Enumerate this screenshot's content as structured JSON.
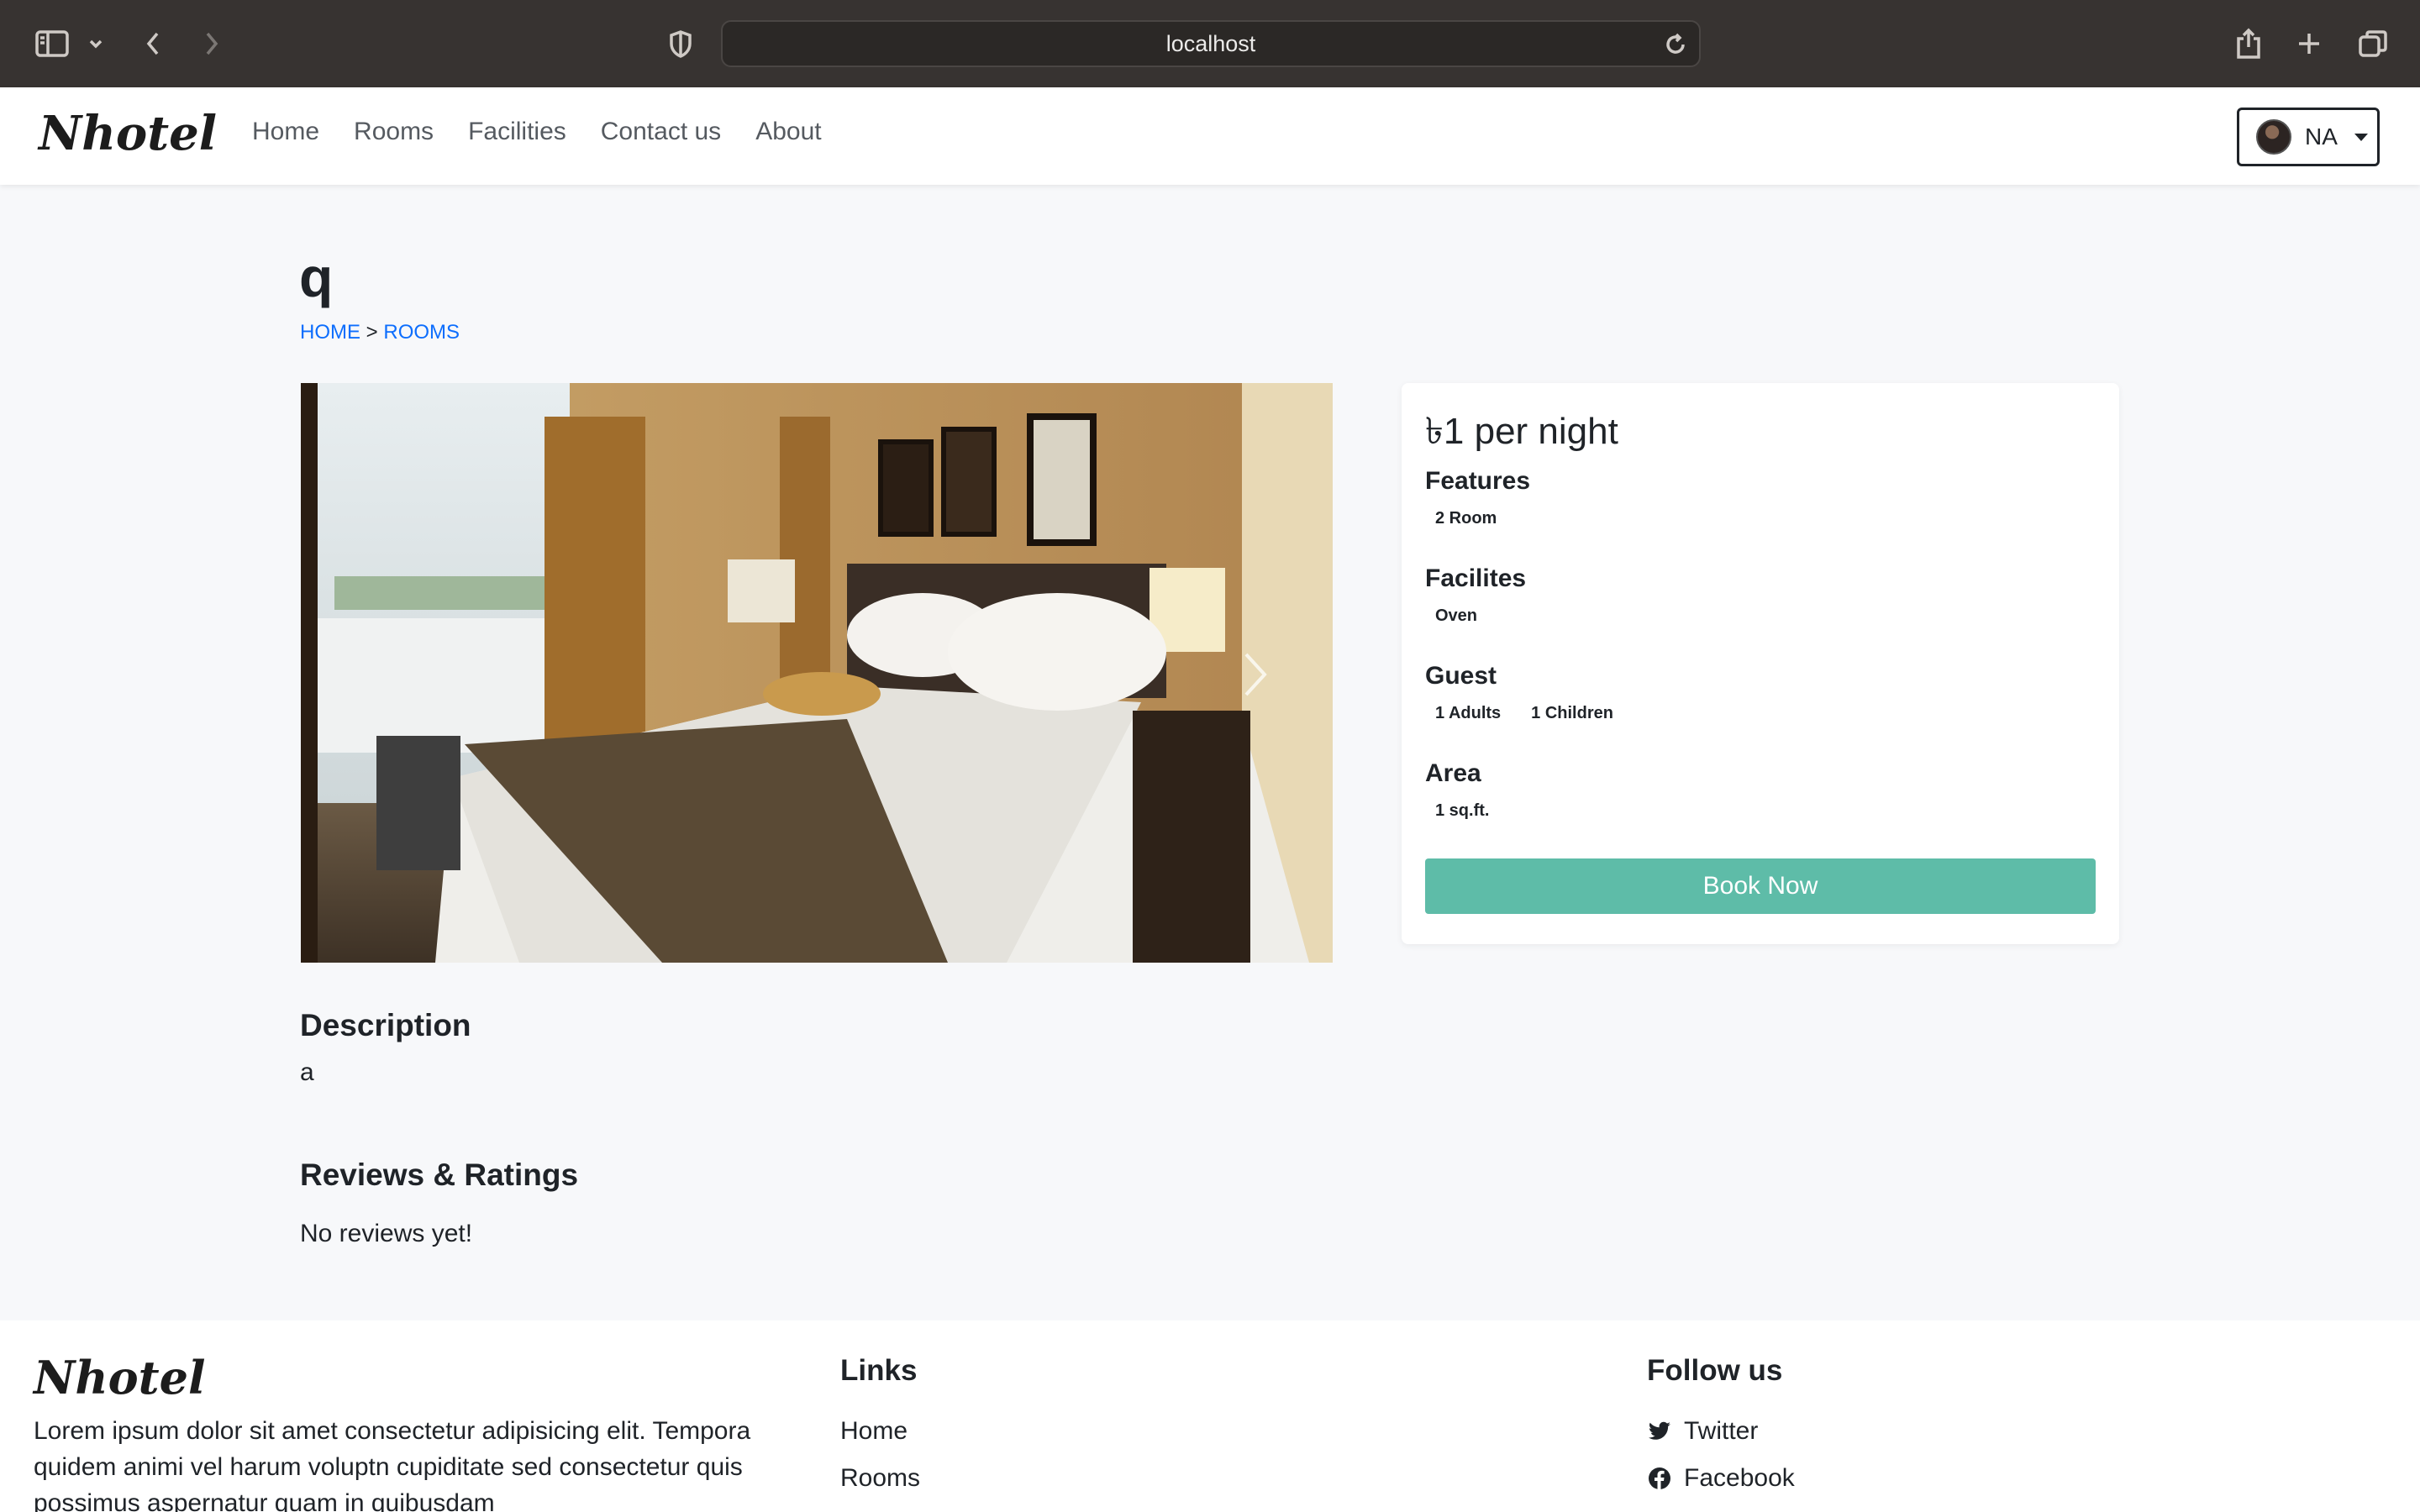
{
  "browser": {
    "url": "localhost"
  },
  "navbar": {
    "brand": "Nhotel",
    "links": [
      "Home",
      "Rooms",
      "Facilities",
      "Contact us",
      "About"
    ],
    "user_initials": "NA"
  },
  "room": {
    "title": "q",
    "breadcrumb": {
      "home": "HOME",
      "separator": ">",
      "rooms": "ROOMS"
    },
    "price": "৳1 per night",
    "features_title": "Features",
    "features": [
      "2 Room"
    ],
    "facilities_title": "Facilites",
    "facilities": [
      "Oven"
    ],
    "guest_title": "Guest",
    "guests": [
      "1 Adults",
      "1 Children"
    ],
    "area_title": "Area",
    "area": [
      "1 sq.ft."
    ],
    "book_label": "Book Now",
    "description_title": "Description",
    "description": "a",
    "reviews_title": "Reviews & Ratings",
    "reviews_text": "No reviews yet!"
  },
  "footer": {
    "brand": "Nhotel",
    "about": "Lorem ipsum dolor sit amet consectetur adipisicing elit. Tempora quidem animi vel harum voluptn cupiditate sed consectetur quis possimus aspernatur quam in quibusdam",
    "links_title": "Links",
    "links": [
      "Home",
      "Rooms"
    ],
    "follow_title": "Follow us",
    "social": [
      "Twitter",
      "Facebook"
    ]
  },
  "colors": {
    "book_button": "#5ebca8",
    "breadcrumb_link": "#0d6efd",
    "page_background": "#f7f8fa"
  }
}
